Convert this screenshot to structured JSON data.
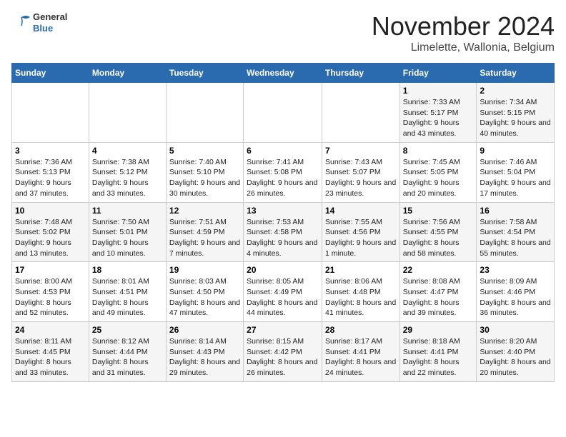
{
  "logo": {
    "general": "General",
    "blue": "Blue"
  },
  "header": {
    "month": "November 2024",
    "location": "Limelette, Wallonia, Belgium"
  },
  "weekdays": [
    "Sunday",
    "Monday",
    "Tuesday",
    "Wednesday",
    "Thursday",
    "Friday",
    "Saturday"
  ],
  "weeks": [
    [
      {
        "day": "",
        "info": ""
      },
      {
        "day": "",
        "info": ""
      },
      {
        "day": "",
        "info": ""
      },
      {
        "day": "",
        "info": ""
      },
      {
        "day": "",
        "info": ""
      },
      {
        "day": "1",
        "info": "Sunrise: 7:33 AM\nSunset: 5:17 PM\nDaylight: 9 hours and 43 minutes."
      },
      {
        "day": "2",
        "info": "Sunrise: 7:34 AM\nSunset: 5:15 PM\nDaylight: 9 hours and 40 minutes."
      }
    ],
    [
      {
        "day": "3",
        "info": "Sunrise: 7:36 AM\nSunset: 5:13 PM\nDaylight: 9 hours and 37 minutes."
      },
      {
        "day": "4",
        "info": "Sunrise: 7:38 AM\nSunset: 5:12 PM\nDaylight: 9 hours and 33 minutes."
      },
      {
        "day": "5",
        "info": "Sunrise: 7:40 AM\nSunset: 5:10 PM\nDaylight: 9 hours and 30 minutes."
      },
      {
        "day": "6",
        "info": "Sunrise: 7:41 AM\nSunset: 5:08 PM\nDaylight: 9 hours and 26 minutes."
      },
      {
        "day": "7",
        "info": "Sunrise: 7:43 AM\nSunset: 5:07 PM\nDaylight: 9 hours and 23 minutes."
      },
      {
        "day": "8",
        "info": "Sunrise: 7:45 AM\nSunset: 5:05 PM\nDaylight: 9 hours and 20 minutes."
      },
      {
        "day": "9",
        "info": "Sunrise: 7:46 AM\nSunset: 5:04 PM\nDaylight: 9 hours and 17 minutes."
      }
    ],
    [
      {
        "day": "10",
        "info": "Sunrise: 7:48 AM\nSunset: 5:02 PM\nDaylight: 9 hours and 13 minutes."
      },
      {
        "day": "11",
        "info": "Sunrise: 7:50 AM\nSunset: 5:01 PM\nDaylight: 9 hours and 10 minutes."
      },
      {
        "day": "12",
        "info": "Sunrise: 7:51 AM\nSunset: 4:59 PM\nDaylight: 9 hours and 7 minutes."
      },
      {
        "day": "13",
        "info": "Sunrise: 7:53 AM\nSunset: 4:58 PM\nDaylight: 9 hours and 4 minutes."
      },
      {
        "day": "14",
        "info": "Sunrise: 7:55 AM\nSunset: 4:56 PM\nDaylight: 9 hours and 1 minute."
      },
      {
        "day": "15",
        "info": "Sunrise: 7:56 AM\nSunset: 4:55 PM\nDaylight: 8 hours and 58 minutes."
      },
      {
        "day": "16",
        "info": "Sunrise: 7:58 AM\nSunset: 4:54 PM\nDaylight: 8 hours and 55 minutes."
      }
    ],
    [
      {
        "day": "17",
        "info": "Sunrise: 8:00 AM\nSunset: 4:53 PM\nDaylight: 8 hours and 52 minutes."
      },
      {
        "day": "18",
        "info": "Sunrise: 8:01 AM\nSunset: 4:51 PM\nDaylight: 8 hours and 49 minutes."
      },
      {
        "day": "19",
        "info": "Sunrise: 8:03 AM\nSunset: 4:50 PM\nDaylight: 8 hours and 47 minutes."
      },
      {
        "day": "20",
        "info": "Sunrise: 8:05 AM\nSunset: 4:49 PM\nDaylight: 8 hours and 44 minutes."
      },
      {
        "day": "21",
        "info": "Sunrise: 8:06 AM\nSunset: 4:48 PM\nDaylight: 8 hours and 41 minutes."
      },
      {
        "day": "22",
        "info": "Sunrise: 8:08 AM\nSunset: 4:47 PM\nDaylight: 8 hours and 39 minutes."
      },
      {
        "day": "23",
        "info": "Sunrise: 8:09 AM\nSunset: 4:46 PM\nDaylight: 8 hours and 36 minutes."
      }
    ],
    [
      {
        "day": "24",
        "info": "Sunrise: 8:11 AM\nSunset: 4:45 PM\nDaylight: 8 hours and 33 minutes."
      },
      {
        "day": "25",
        "info": "Sunrise: 8:12 AM\nSunset: 4:44 PM\nDaylight: 8 hours and 31 minutes."
      },
      {
        "day": "26",
        "info": "Sunrise: 8:14 AM\nSunset: 4:43 PM\nDaylight: 8 hours and 29 minutes."
      },
      {
        "day": "27",
        "info": "Sunrise: 8:15 AM\nSunset: 4:42 PM\nDaylight: 8 hours and 26 minutes."
      },
      {
        "day": "28",
        "info": "Sunrise: 8:17 AM\nSunset: 4:41 PM\nDaylight: 8 hours and 24 minutes."
      },
      {
        "day": "29",
        "info": "Sunrise: 8:18 AM\nSunset: 4:41 PM\nDaylight: 8 hours and 22 minutes."
      },
      {
        "day": "30",
        "info": "Sunrise: 8:20 AM\nSunset: 4:40 PM\nDaylight: 8 hours and 20 minutes."
      }
    ]
  ]
}
